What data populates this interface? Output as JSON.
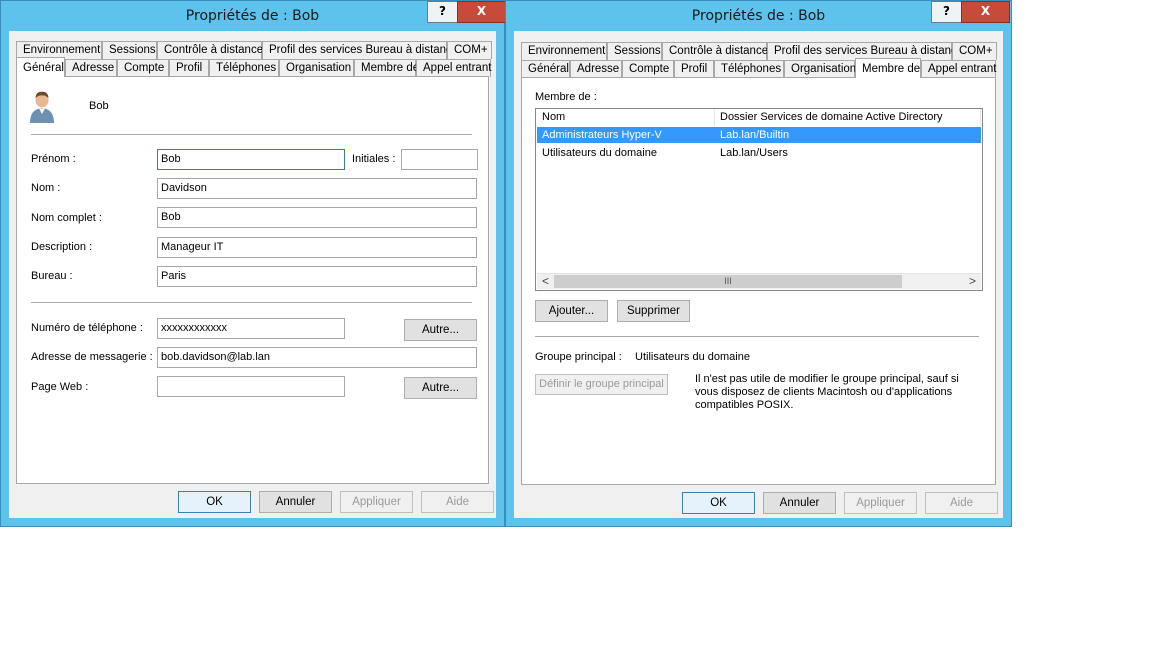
{
  "window1": {
    "title": "Propriétés de : Bob",
    "help_glyph": "?",
    "close_glyph": "X",
    "tabs_row1": [
      "Environnement",
      "Sessions",
      "Contrôle à distance",
      "Profil des services Bureau à distance",
      "COM+"
    ],
    "tabs_row2": [
      "Général",
      "Adresse",
      "Compte",
      "Profil",
      "Téléphones",
      "Organisation",
      "Membre de",
      "Appel entrant"
    ],
    "active_tab": "Général",
    "user_name": "Bob",
    "labels": {
      "first_name": "Prénom :",
      "initials": "Initiales :",
      "last_name": "Nom :",
      "full_name": "Nom complet :",
      "description": "Description :",
      "office": "Bureau :",
      "phone": "Numéro de téléphone :",
      "email": "Adresse de messagerie :",
      "web_page": "Page Web :"
    },
    "values": {
      "first_name": "Bob",
      "initials": "",
      "last_name": "Davidson",
      "full_name": "Bob",
      "description": "Manageur IT",
      "office": "Paris",
      "phone": "xxxxxxxxxxxx",
      "email": "bob.davidson@lab.lan",
      "web_page": ""
    },
    "other_label": "Autre...",
    "buttons": {
      "ok": "OK",
      "cancel": "Annuler",
      "apply": "Appliquer",
      "help": "Aide"
    }
  },
  "window2": {
    "title": "Propriétés de : Bob",
    "help_glyph": "?",
    "close_glyph": "X",
    "tabs_row1": [
      "Environnement",
      "Sessions",
      "Contrôle à distance",
      "Profil des services Bureau à distance",
      "COM+"
    ],
    "tabs_row2": [
      "Général",
      "Adresse",
      "Compte",
      "Profil",
      "Téléphones",
      "Organisation",
      "Membre de",
      "Appel entrant"
    ],
    "active_tab": "Membre de",
    "member_of_label": "Membre de :",
    "columns": [
      "Nom",
      "Dossier Services de domaine Active Directory"
    ],
    "rows": [
      {
        "name": "Administrateurs Hyper-V",
        "folder": "Lab.lan/Builtin",
        "selected": true
      },
      {
        "name": "Utilisateurs du domaine",
        "folder": "Lab.lan/Users",
        "selected": false
      }
    ],
    "scroll_left": "<",
    "scroll_right": ">",
    "scroll_grip": "III",
    "add_button": "Ajouter...",
    "remove_button": "Supprimer",
    "primary_group_label": "Groupe principal :",
    "primary_group_value": "Utilisateurs du domaine",
    "set_primary_button": "Définir le groupe principal",
    "note": "Il n'est pas utile de modifier le groupe principal, sauf si vous disposez de clients Macintosh ou d'applications compatibles POSIX.",
    "buttons": {
      "ok": "OK",
      "cancel": "Annuler",
      "apply": "Appliquer",
      "help": "Aide"
    }
  }
}
